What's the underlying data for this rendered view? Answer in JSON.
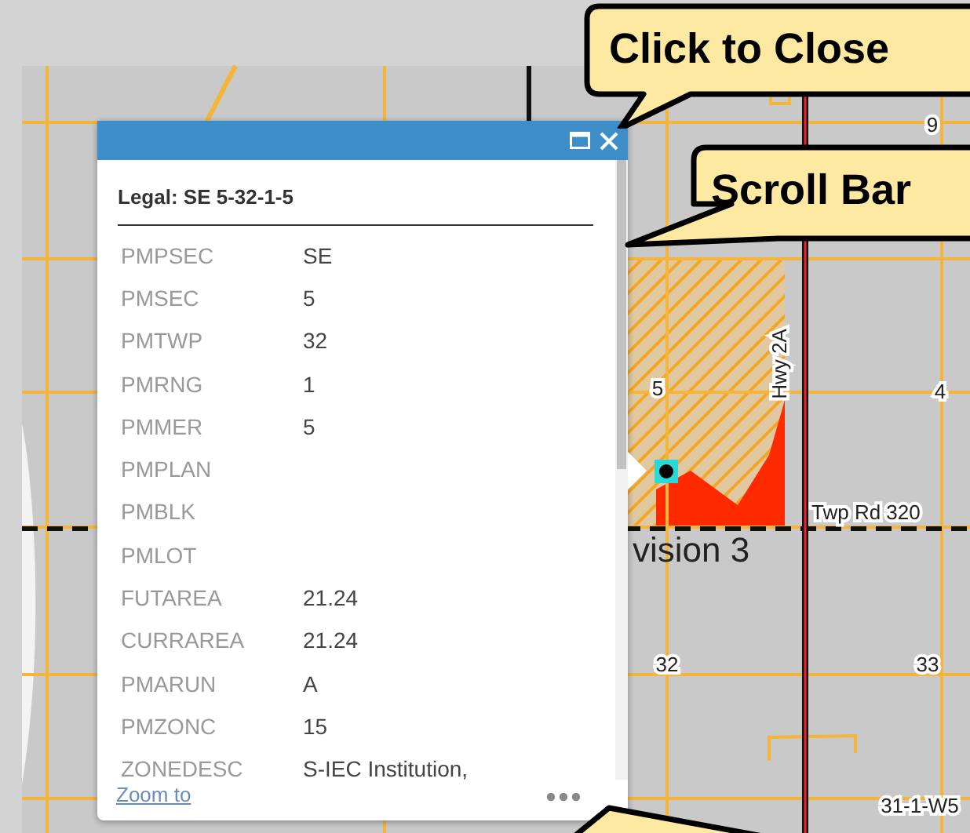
{
  "map": {
    "labels": [
      {
        "kind": "section",
        "text": "9"
      },
      {
        "kind": "section",
        "text": "5"
      },
      {
        "kind": "section",
        "text": "4"
      },
      {
        "kind": "section",
        "text": "32"
      },
      {
        "kind": "section",
        "text": "33"
      },
      {
        "kind": "section",
        "text": "31-1-W5"
      },
      {
        "kind": "road_vertical",
        "text": "Hwy 2A"
      },
      {
        "kind": "road",
        "text": "Twp Rd 320"
      },
      {
        "kind": "area",
        "text": "vision 3"
      }
    ]
  },
  "popup": {
    "title": "Legal: SE 5-32-1-5",
    "fields": [
      {
        "name": "PMPSEC",
        "value": "SE"
      },
      {
        "name": "PMSEC",
        "value": "5"
      },
      {
        "name": "PMTWP",
        "value": "32"
      },
      {
        "name": "PMRNG",
        "value": "1"
      },
      {
        "name": "PMMER",
        "value": "5"
      },
      {
        "name": "PMPLAN"
      },
      {
        "name": "PMBLK"
      },
      {
        "name": "PMLOT"
      },
      {
        "name": "FUTAREA",
        "value": "21.24"
      },
      {
        "name": "CURRAREA",
        "value": "21.24"
      },
      {
        "name": "PMARUN",
        "value": "A"
      },
      {
        "name": "PMZONC",
        "value": "15"
      },
      {
        "name": "ZONEDESC",
        "value": "S-IEC Institution,"
      }
    ],
    "link": "Zoom to"
  },
  "callouts": [
    {
      "text": "Click to Close"
    },
    {
      "text": "Scroll Bar"
    }
  ]
}
